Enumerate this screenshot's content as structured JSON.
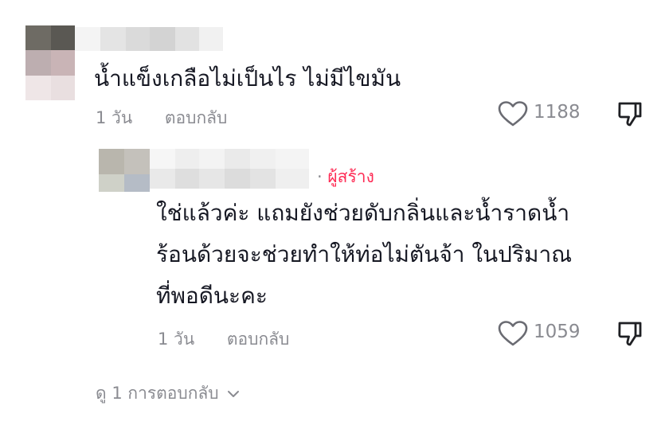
{
  "comment": {
    "text": "น้ำแข็งเกลือไม่เป็นไร ไม่มีไขมัน",
    "time": "1 วัน",
    "reply_label": "ตอบกลับ",
    "likes": "1188",
    "like_icon": "heart-outline-icon",
    "dislike_icon": "thumbs-down-icon"
  },
  "reply": {
    "badge_separator": "·",
    "badge": "ผู้สร้าง",
    "lines": [
      "ใช่แล้วค่ะ แถมยังช่วยดับกลิ่นและน้ำราดน้ำ",
      "ร้อนด้วยจะช่วยทำให้ท่อไม่ตันจ้า ในปริมาณ",
      "ที่พอดีนะคะ"
    ],
    "time": "1 วัน",
    "reply_label": "ตอบกลับ",
    "likes": "1059",
    "like_icon": "heart-outline-icon",
    "dislike_icon": "thumbs-down-icon"
  },
  "view_replies": {
    "label": "ดู 1 การตอบกลับ",
    "icon": "chevron-down-icon"
  },
  "colors": {
    "text": "#161823",
    "muted": "#8a8b91",
    "creator": "#fe2c55"
  }
}
